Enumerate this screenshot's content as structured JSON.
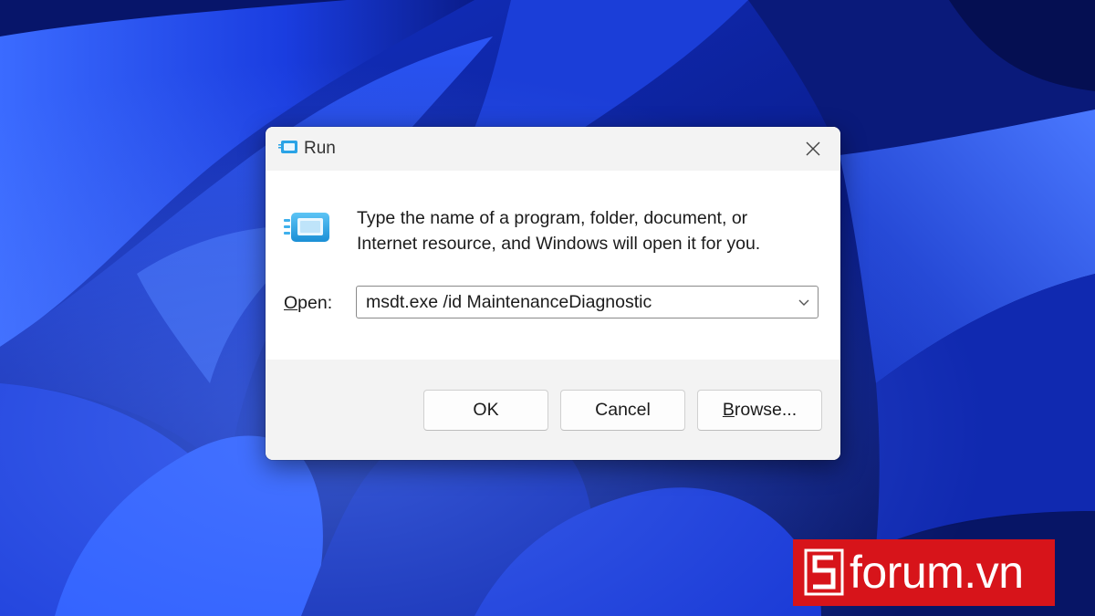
{
  "desktop": {
    "wallpaper": "windows-11-bloom-wallpaper",
    "colors": {
      "deep": "#071359",
      "mid": "#1637d6",
      "light": "#3e6cff"
    }
  },
  "run_dialog": {
    "title": "Run",
    "title_icon": "run-app-icon",
    "close_icon": "close-icon",
    "description_line1": "Type the name of a program, folder, document, or",
    "description_line2": "Internet resource, and Windows will open it for you.",
    "open_label_mnemonic": "O",
    "open_label_rest": "pen:",
    "open_value": "msdt.exe /id MaintenanceDiagnostic",
    "dropdown_icon": "chevron-down-icon",
    "buttons": {
      "ok": "OK",
      "cancel": "Cancel",
      "browse_mnemonic": "B",
      "browse_rest": "rowse..."
    }
  },
  "watermark": {
    "text": "forum.vn",
    "logo": "sforum-s-logo-icon",
    "color": "#d7141a"
  }
}
